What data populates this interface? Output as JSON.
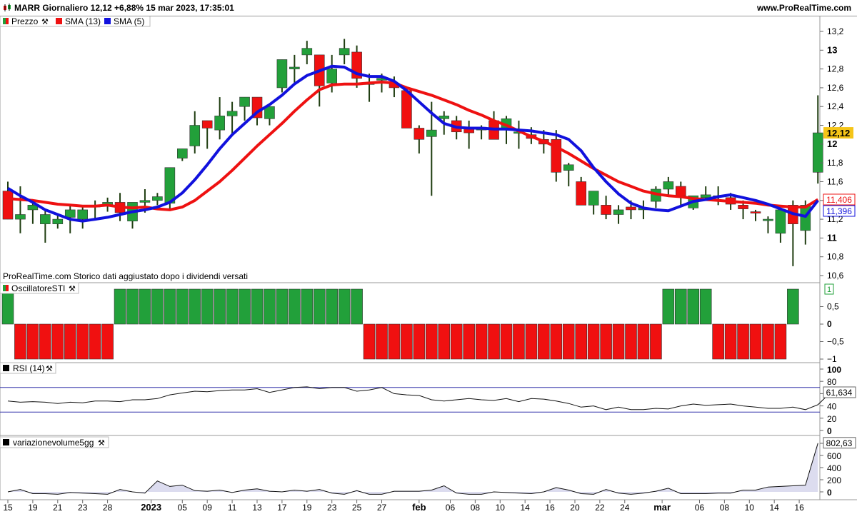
{
  "header": {
    "title": "MARR Giornaliero 12,12 +6,88% 15 mar 2023, 17:35:01",
    "site": "www.ProRealTime.com"
  },
  "legend": {
    "price": "Prezzo",
    "sma13": "SMA (13)",
    "sma5": "SMA (5)"
  },
  "note": "ProRealTime.com  Storico dati aggiustato dopo i dividendi versati",
  "colors": {
    "up": "#22a03a",
    "down": "#f01010",
    "sma13": "#ee1111",
    "sma5": "#1111dd",
    "rsi_level": "#3333aa",
    "volume_fill": "#dcdcef",
    "price_badge": "#f5c518"
  },
  "chart_data": [
    {
      "type": "candlestick",
      "name": "price",
      "yticks": [
        "10,6",
        "10,8",
        "11",
        "11,2",
        "11,4",
        "11,6",
        "11,8",
        "12",
        "12,2",
        "12,4",
        "12,6",
        "12,8",
        "13",
        "13,2"
      ],
      "ytick_values": [
        10.6,
        10.8,
        11,
        11.2,
        11.4,
        11.6,
        11.8,
        12,
        12.2,
        12.4,
        12.6,
        12.8,
        13,
        13.2
      ],
      "ylim": [
        10.5,
        13.3
      ],
      "last_price_label": "12,12",
      "sma13_label": "11,406",
      "sma5_label": "11,396",
      "ohlc": [
        [
          11.5,
          11.6,
          11.2,
          11.2
        ],
        [
          11.2,
          11.55,
          11.05,
          11.25
        ],
        [
          11.3,
          11.4,
          11.15,
          11.35
        ],
        [
          11.15,
          11.3,
          10.95,
          11.25
        ],
        [
          11.15,
          11.25,
          11.1,
          11.2
        ],
        [
          11.22,
          11.35,
          11.05,
          11.3
        ],
        [
          11.2,
          11.35,
          11.1,
          11.3
        ],
        [
          11.33,
          11.4,
          11.2,
          11.35
        ],
        [
          11.35,
          11.43,
          11.28,
          11.38
        ],
        [
          11.38,
          11.48,
          11.18,
          11.27
        ],
        [
          11.18,
          11.35,
          11.1,
          11.38
        ],
        [
          11.38,
          11.52,
          11.27,
          11.4
        ],
        [
          11.4,
          11.48,
          11.35,
          11.44
        ],
        [
          11.37,
          11.55,
          11.3,
          11.75
        ],
        [
          11.85,
          11.95,
          11.82,
          11.95
        ],
        [
          11.98,
          12.35,
          11.9,
          12.2
        ],
        [
          12.25,
          12.25,
          11.95,
          12.17
        ],
        [
          12.15,
          12.5,
          12.05,
          12.3
        ],
        [
          12.3,
          12.45,
          12.1,
          12.35
        ],
        [
          12.4,
          12.5,
          12.25,
          12.5
        ],
        [
          12.5,
          12.5,
          12.2,
          12.28
        ],
        [
          12.27,
          12.35,
          12.2,
          12.4
        ],
        [
          12.6,
          12.9,
          12.55,
          12.9
        ],
        [
          12.8,
          12.95,
          12.65,
          12.82
        ],
        [
          12.95,
          13.1,
          12.85,
          13.02
        ],
        [
          12.95,
          12.95,
          12.4,
          12.62
        ],
        [
          12.65,
          12.95,
          12.55,
          12.8
        ],
        [
          12.95,
          13.12,
          12.85,
          13.02
        ],
        [
          12.98,
          13.05,
          12.6,
          12.7
        ],
        [
          12.65,
          12.75,
          12.45,
          12.65
        ],
        [
          12.68,
          12.75,
          12.55,
          12.7
        ],
        [
          12.65,
          12.72,
          12.5,
          12.6
        ],
        [
          12.57,
          12.6,
          12.2,
          12.17
        ],
        [
          12.17,
          12.2,
          11.9,
          12.05
        ],
        [
          12.08,
          12.45,
          11.45,
          12.15
        ],
        [
          12.27,
          12.35,
          12.1,
          12.3
        ],
        [
          12.25,
          12.3,
          12.05,
          12.13
        ],
        [
          12.16,
          12.25,
          11.95,
          12.12
        ],
        [
          12.15,
          12.2,
          12.05,
          12.18
        ],
        [
          12.25,
          12.35,
          12.05,
          12.05
        ],
        [
          12.17,
          12.3,
          12.0,
          12.27
        ],
        [
          12.13,
          12.25,
          11.95,
          12.13
        ],
        [
          12.1,
          12.18,
          12.0,
          12.06
        ],
        [
          12.05,
          12.15,
          11.9,
          12.0
        ],
        [
          12.05,
          12.15,
          11.6,
          11.7
        ],
        [
          11.72,
          11.8,
          11.55,
          11.78
        ],
        [
          11.6,
          11.65,
          11.35,
          11.35
        ],
        [
          11.35,
          11.5,
          11.25,
          11.5
        ],
        [
          11.35,
          11.45,
          11.2,
          11.25
        ],
        [
          11.25,
          11.35,
          11.15,
          11.3
        ],
        [
          11.33,
          11.4,
          11.2,
          11.3
        ],
        [
          11.3,
          11.4,
          11.2,
          11.32
        ],
        [
          11.39,
          11.55,
          11.32,
          11.52
        ],
        [
          11.52,
          11.65,
          11.45,
          11.6
        ],
        [
          11.55,
          11.6,
          11.35,
          11.45
        ],
        [
          11.32,
          11.4,
          11.3,
          11.45
        ],
        [
          11.43,
          11.55,
          11.4,
          11.46
        ],
        [
          11.45,
          11.55,
          11.35,
          11.45
        ],
        [
          11.43,
          11.48,
          11.3,
          11.36
        ],
        [
          11.35,
          11.4,
          11.2,
          11.31
        ],
        [
          11.28,
          11.3,
          11.18,
          11.27
        ],
        [
          11.2,
          11.23,
          11.05,
          11.2
        ],
        [
          11.05,
          11.3,
          10.95,
          11.3
        ],
        [
          11.35,
          11.4,
          10.7,
          11.15
        ],
        [
          11.08,
          11.4,
          10.93,
          11.35
        ],
        [
          11.7,
          12.52,
          11.58,
          12.12
        ]
      ],
      "sma13": [
        11.42,
        11.41,
        11.4,
        11.38,
        11.36,
        11.35,
        11.34,
        11.34,
        11.35,
        11.33,
        11.32,
        11.33,
        11.31,
        11.3,
        11.33,
        11.4,
        11.5,
        11.6,
        11.72,
        11.85,
        11.98,
        12.1,
        12.22,
        12.35,
        12.47,
        12.58,
        12.63,
        12.64,
        12.64,
        12.65,
        12.66,
        12.65,
        12.6,
        12.56,
        12.52,
        12.47,
        12.42,
        12.36,
        12.31,
        12.25,
        12.2,
        12.14,
        12.08,
        12.03,
        11.97,
        11.9,
        11.82,
        11.74,
        11.67,
        11.6,
        11.55,
        11.5,
        11.47,
        11.45,
        11.44,
        11.42,
        11.41,
        11.4,
        11.39,
        11.38,
        11.37,
        11.35,
        11.34,
        11.33,
        11.33,
        11.41
      ],
      "sma5": [
        11.53,
        11.45,
        11.38,
        11.3,
        11.25,
        11.2,
        11.18,
        11.2,
        11.22,
        11.25,
        11.28,
        11.3,
        11.33,
        11.38,
        11.48,
        11.62,
        11.78,
        11.95,
        12.1,
        12.22,
        12.34,
        12.42,
        12.52,
        12.64,
        12.73,
        12.78,
        12.83,
        12.82,
        12.75,
        12.72,
        12.72,
        12.67,
        12.57,
        12.45,
        12.33,
        12.22,
        12.18,
        12.17,
        12.17,
        12.16,
        12.16,
        12.15,
        12.14,
        12.12,
        12.1,
        12.05,
        11.93,
        11.75,
        11.6,
        11.47,
        11.37,
        11.32,
        11.3,
        11.29,
        11.34,
        11.39,
        11.41,
        11.44,
        11.46,
        11.43,
        11.4,
        11.36,
        11.31,
        11.26,
        11.23,
        11.4
      ]
    },
    {
      "type": "bar",
      "name": "OscillatoreSTI",
      "label": "OscillatoreSTI",
      "yticks": [
        "0,5",
        "0",
        "−0,5",
        "−1"
      ],
      "ytick_values": [
        0.5,
        0,
        -0.5,
        -1
      ],
      "ylim": [
        -1.1,
        1.1
      ],
      "last_value_label": "1",
      "values": [
        1,
        -1,
        -1,
        -1,
        -1,
        -1,
        -1,
        -1,
        -1,
        1,
        1,
        1,
        1,
        1,
        1,
        1,
        1,
        1,
        1,
        1,
        1,
        1,
        1,
        1,
        1,
        1,
        1,
        1,
        1,
        -1,
        -1,
        -1,
        -1,
        -1,
        -1,
        -1,
        -1,
        -1,
        -1,
        -1,
        -1,
        -1,
        -1,
        -1,
        -1,
        -1,
        -1,
        -1,
        -1,
        -1,
        -1,
        -1,
        -1,
        1,
        1,
        1,
        1,
        -1,
        -1,
        -1,
        -1,
        -1,
        -1,
        1
      ]
    },
    {
      "type": "line",
      "name": "RSI (14)",
      "label": "RSI (14)",
      "yticks": [
        "100",
        "80",
        "60",
        "40",
        "20",
        "0"
      ],
      "ytick_values": [
        100,
        80,
        60,
        40,
        20,
        0
      ],
      "ylim": [
        0,
        100
      ],
      "levels": [
        70,
        30
      ],
      "last_value_label": "61,634",
      "values": [
        48,
        46,
        47,
        46,
        44,
        46,
        45,
        48,
        48,
        47,
        50,
        50,
        52,
        58,
        61,
        64,
        63,
        65,
        66,
        66,
        68,
        62,
        66,
        70,
        71,
        68,
        70,
        70,
        64,
        66,
        70,
        60,
        58,
        57,
        50,
        48,
        50,
        52,
        50,
        49,
        52,
        47,
        52,
        51,
        48,
        44,
        38,
        40,
        34,
        38,
        34,
        34,
        36,
        35,
        40,
        43,
        41,
        42,
        43,
        40,
        38,
        36,
        36,
        38,
        34,
        42,
        61.6
      ]
    },
    {
      "type": "area",
      "name": "variazionevolume5gg",
      "label": "variazionevolume5gg",
      "yticks": [
        "800",
        "600",
        "400",
        "200",
        "0"
      ],
      "ytick_values": [
        800,
        600,
        400,
        200,
        0
      ],
      "ylim": [
        -150,
        850
      ],
      "last_value_label": "802,63",
      "values": [
        0,
        40,
        -30,
        -30,
        -40,
        -10,
        -20,
        -30,
        -40,
        40,
        0,
        -20,
        180,
        90,
        110,
        20,
        10,
        30,
        -10,
        30,
        50,
        10,
        0,
        30,
        10,
        40,
        -20,
        -40,
        20,
        -40,
        -40,
        10,
        10,
        10,
        30,
        100,
        -20,
        -40,
        -40,
        0,
        -10,
        -20,
        -30,
        0,
        70,
        30,
        -30,
        -40,
        40,
        -20,
        -40,
        -20,
        10,
        60,
        -30,
        -30,
        -30,
        -20,
        -20,
        30,
        30,
        80,
        90,
        100,
        110,
        802.63
      ]
    }
  ],
  "x_axis": {
    "labels": [
      {
        "i": 0,
        "text": "15",
        "bold": false
      },
      {
        "i": 2,
        "text": "19",
        "bold": false
      },
      {
        "i": 4,
        "text": "21",
        "bold": false
      },
      {
        "i": 6,
        "text": "23",
        "bold": false
      },
      {
        "i": 8,
        "text": "28",
        "bold": false
      },
      {
        "i": 11.5,
        "text": "2023",
        "bold": true
      },
      {
        "i": 14,
        "text": "05",
        "bold": false
      },
      {
        "i": 16,
        "text": "09",
        "bold": false
      },
      {
        "i": 18,
        "text": "11",
        "bold": false
      },
      {
        "i": 20,
        "text": "13",
        "bold": false
      },
      {
        "i": 22,
        "text": "17",
        "bold": false
      },
      {
        "i": 24,
        "text": "19",
        "bold": false
      },
      {
        "i": 26,
        "text": "23",
        "bold": false
      },
      {
        "i": 28,
        "text": "25",
        "bold": false
      },
      {
        "i": 30,
        "text": "27",
        "bold": false
      },
      {
        "i": 33,
        "text": "feb",
        "bold": true
      },
      {
        "i": 35.5,
        "text": "06",
        "bold": false
      },
      {
        "i": 37.5,
        "text": "08",
        "bold": false
      },
      {
        "i": 39.5,
        "text": "10",
        "bold": false
      },
      {
        "i": 41.5,
        "text": "14",
        "bold": false
      },
      {
        "i": 43.5,
        "text": "16",
        "bold": false
      },
      {
        "i": 45.5,
        "text": "20",
        "bold": false
      },
      {
        "i": 47.5,
        "text": "22",
        "bold": false
      },
      {
        "i": 49.5,
        "text": "24",
        "bold": false
      },
      {
        "i": 52.5,
        "text": "mar",
        "bold": true
      },
      {
        "i": 55.5,
        "text": "06",
        "bold": false
      },
      {
        "i": 57.5,
        "text": "08",
        "bold": false
      },
      {
        "i": 59.5,
        "text": "10",
        "bold": false
      },
      {
        "i": 61.5,
        "text": "14",
        "bold": false
      },
      {
        "i": 63.5,
        "text": "16",
        "bold": false
      }
    ]
  }
}
